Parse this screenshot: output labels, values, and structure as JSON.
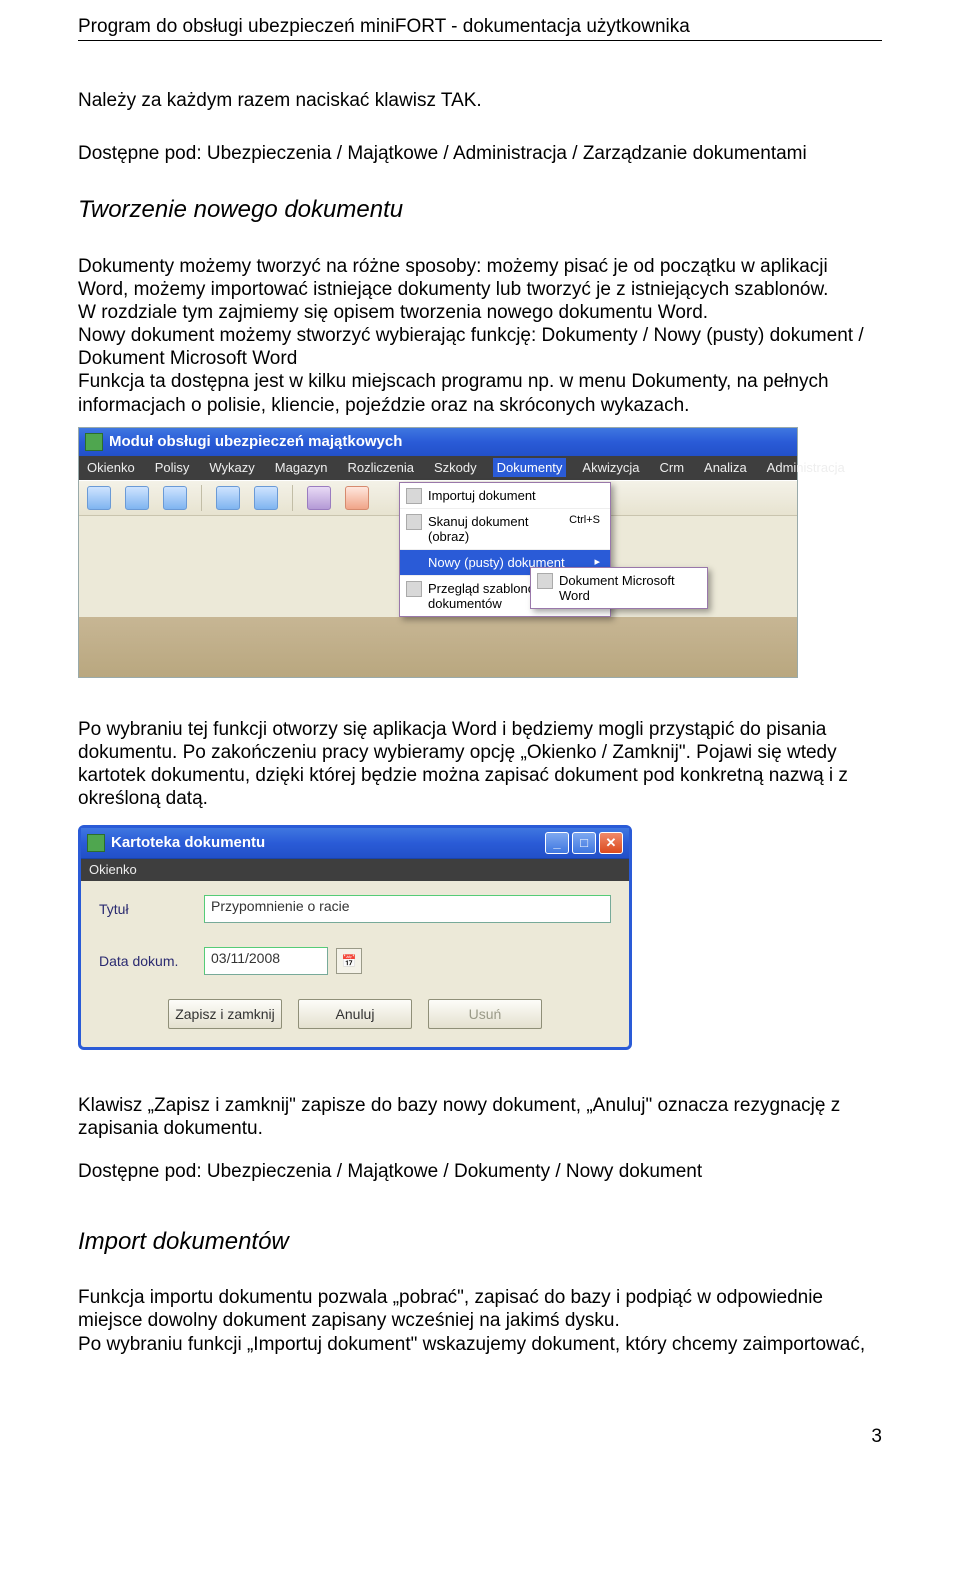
{
  "header": "Program do obsługi ubezpieczeń miniFORT - dokumentacja użytkownika",
  "p1": "Należy za każdym razem naciskać klawisz TAK.",
  "p2": "Dostępne pod: Ubezpieczenia / Majątkowe / Administracja / Zarządzanie dokumentami",
  "h2a": "Tworzenie nowego dokumentu",
  "p3": "Dokumenty możemy tworzyć na różne sposoby: możemy pisać je od początku w aplikacji Word, możemy importować istniejące dokumenty lub tworzyć je z istniejących szablonów.",
  "p4": "W rozdziale tym zajmiemy się opisem tworzenia nowego dokumentu Word.",
  "p5": "Nowy dokument możemy stworzyć wybierając funkcję: Dokumenty / Nowy (pusty) dokument / Dokument Microsoft Word",
  "p6": "Funkcja ta dostępna jest w kilku miejscach programu np. w menu Dokumenty, na pełnych informacjach o polisie, kliencie, pojeździe oraz na skróconych wykazach.",
  "shot1": {
    "title": "Moduł obsługi ubezpieczeń majątkowych",
    "menu": [
      "Okienko",
      "Polisy",
      "Wykazy",
      "Magazyn",
      "Rozliczenia",
      "Szkody",
      "Dokumenty",
      "Akwizycja",
      "Crm",
      "Analiza",
      "Administracja"
    ],
    "dropdown": [
      {
        "label": "Importuj dokument",
        "shortcut": ""
      },
      {
        "label": "Skanuj dokument (obraz)",
        "shortcut": "Ctrl+S"
      },
      {
        "label": "Nowy (pusty) dokument",
        "shortcut": "▸",
        "hover": true
      },
      {
        "label": "Przegląd szablonów dokumentów",
        "shortcut": ""
      }
    ],
    "sub": "Dokument Microsoft Word"
  },
  "p7": "Po wybraniu tej funkcji otworzy się aplikacja Word i będziemy mogli przystąpić do pisania dokumentu. Po zakończeniu pracy wybieramy opcję „Okienko / Zamknij\". Pojawi się wtedy kartotek dokumentu, dzięki której będzie można zapisać dokument pod konkretną nazwą i z określoną datą.",
  "shot2": {
    "title": "Kartoteka dokumentu",
    "menu": "Okienko",
    "label_title": "Tytuł",
    "val_title": "Przypomnienie o racie",
    "label_date": "Data dokum.",
    "val_date": "03/11/2008",
    "btn_save": "Zapisz i zamknij",
    "btn_cancel": "Anuluj",
    "btn_delete": "Usuń",
    "min": "_",
    "max": "□",
    "close": "✕"
  },
  "p8": "Klawisz „Zapisz i zamknij\" zapisze do bazy nowy dokument, „Anuluj\" oznacza rezygnację z zapisania dokumentu.",
  "p9": "Dostępne pod: Ubezpieczenia / Majątkowe / Dokumenty / Nowy dokument",
  "h2b": "Import dokumentów",
  "p10": "Funkcja importu dokumentu pozwala „pobrać\", zapisać do bazy i podpiąć w odpowiednie miejsce dowolny dokument zapisany wcześniej na jakimś dysku.",
  "p11": "Po wybraniu funkcji „Importuj dokument\" wskazujemy dokument, który chcemy zaimportować,",
  "pagenum": "3"
}
